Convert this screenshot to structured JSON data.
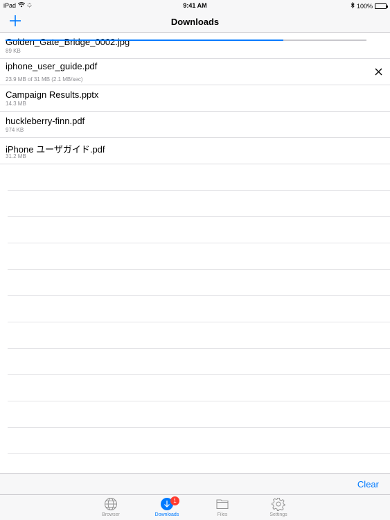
{
  "status_bar": {
    "device": "iPad",
    "time": "9:41 AM",
    "battery": "100%"
  },
  "nav": {
    "title": "Downloads"
  },
  "downloads": [
    {
      "name": "Golden_Gate_Bridge_0002.jpg",
      "meta": "89 KB"
    },
    {
      "name": "iphone_user_guide.pdf",
      "meta": "23.9 MB of 31 MB (2.1 MB/sec)",
      "progress_percent": 77
    },
    {
      "name": "Campaign Results.pptx",
      "meta": "14.3 MB"
    },
    {
      "name": "huckleberry-finn.pdf",
      "meta": "974 KB"
    },
    {
      "name": "iPhone ユーザガイド.pdf",
      "meta": "31.2 MB"
    }
  ],
  "toolbar": {
    "clear_label": "Clear"
  },
  "tabs": [
    {
      "label": "Browser",
      "icon": "globe-icon"
    },
    {
      "label": "Downloads",
      "icon": "download-icon",
      "badge": "1",
      "active": true
    },
    {
      "label": "Files",
      "icon": "folder-icon"
    },
    {
      "label": "Settings",
      "icon": "gear-icon"
    }
  ],
  "colors": {
    "accent": "#007aff",
    "badge": "#ff3b30"
  }
}
